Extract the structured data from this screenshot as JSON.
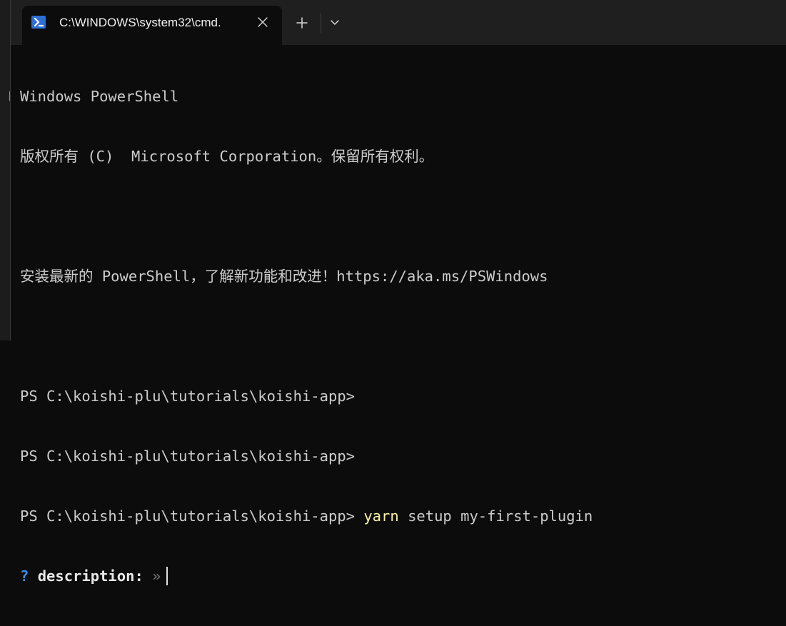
{
  "backdrop": {
    "glyph": "「"
  },
  "tab": {
    "title": "C:\\WINDOWS\\system32\\cmd.",
    "icon": "powershell-icon",
    "close_icon": "close-icon"
  },
  "titlebar": {
    "new_tab_icon": "plus-icon",
    "dropdown_icon": "chevron-down-icon"
  },
  "terminal": {
    "line1": "Windows PowerShell",
    "line2": "版权所有 (C)  Microsoft Corporation。保留所有权利。",
    "line3": "安装最新的 PowerShell，了解新功能和改进！https://aka.ms/PSWindows",
    "prompt1": "PS C:\\koishi-plu\\tutorials\\koishi-app>",
    "prompt2": "PS C:\\koishi-plu\\tutorials\\koishi-app>",
    "prompt3": "PS C:\\koishi-plu\\tutorials\\koishi-app>",
    "command_name": "yarn",
    "command_args": "setup my-first-plugin",
    "question_mark": "?",
    "question_label": "description:",
    "question_hint": "»"
  },
  "colors": {
    "background": "#0c0c0c",
    "titlebar": "#1f1f1f",
    "text": "#cccccc",
    "command_highlight": "#f9f1a5",
    "question_mark": "#3b8eea"
  }
}
